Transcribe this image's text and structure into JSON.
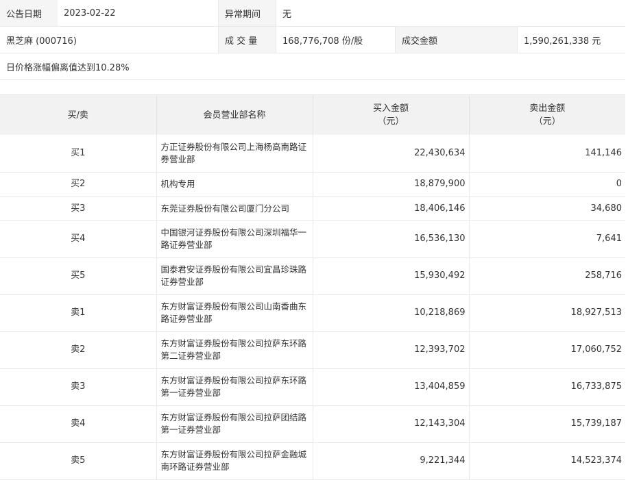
{
  "info": {
    "date_label": "公告日期",
    "date_value": "2023-02-22",
    "period_label": "异常期间",
    "period_value": "无",
    "stock": "黑芝麻 (000716)",
    "volume_label": "成 交 量",
    "volume_value": "168,776,708 份/股",
    "amount_label": "成交金额",
    "amount_value": "1,590,261,338 元",
    "reason": "日价格涨幅偏离值达到10.28%"
  },
  "table": {
    "headers": {
      "side": "买/卖",
      "name": "会员营业部名称",
      "buy": "买入金额",
      "buy_unit": "（元）",
      "sell": "卖出金额",
      "sell_unit": "（元）"
    },
    "rows": [
      {
        "side": "买1",
        "name": "方正证券股份有限公司上海杨高南路证券营业部",
        "buy": "22,430,634",
        "sell": "141,146"
      },
      {
        "side": "买2",
        "name": "机构专用",
        "buy": "18,879,900",
        "sell": "0"
      },
      {
        "side": "买3",
        "name": "东莞证券股份有限公司厦门分公司",
        "buy": "18,406,146",
        "sell": "34,680"
      },
      {
        "side": "买4",
        "name": "中国银河证券股份有限公司深圳福华一路证券营业部",
        "buy": "16,536,130",
        "sell": "7,641"
      },
      {
        "side": "买5",
        "name": "国泰君安证券股份有限公司宜昌珍珠路证券营业部",
        "buy": "15,930,492",
        "sell": "258,716"
      },
      {
        "side": "卖1",
        "name": "东方财富证券股份有限公司山南香曲东路证券营业部",
        "buy": "10,218,869",
        "sell": "18,927,513"
      },
      {
        "side": "卖2",
        "name": "东方财富证券股份有限公司拉萨东环路第二证券营业部",
        "buy": "12,393,702",
        "sell": "17,060,752"
      },
      {
        "side": "卖3",
        "name": "东方财富证券股份有限公司拉萨东环路第一证券营业部",
        "buy": "13,404,859",
        "sell": "16,733,875"
      },
      {
        "side": "卖4",
        "name": "东方财富证券股份有限公司拉萨团结路第一证券营业部",
        "buy": "12,143,304",
        "sell": "15,739,187"
      },
      {
        "side": "卖5",
        "name": "东方财富证券股份有限公司拉萨金融城南环路证券营业部",
        "buy": "9,221,344",
        "sell": "14,523,374"
      }
    ]
  }
}
